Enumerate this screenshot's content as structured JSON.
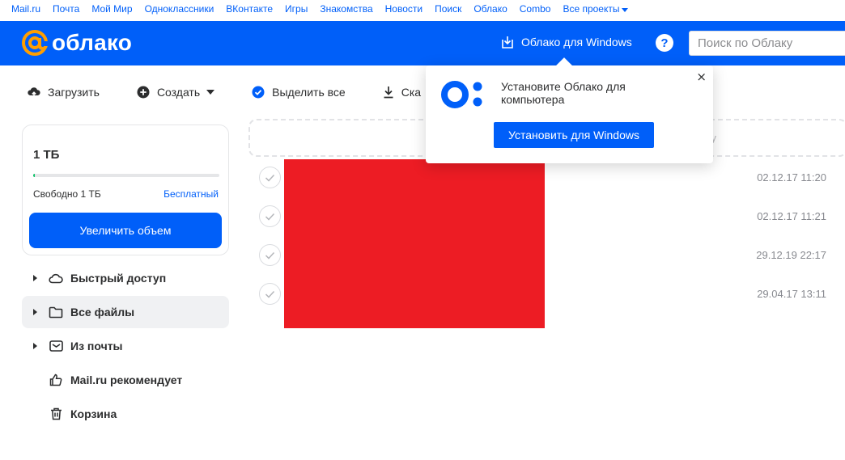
{
  "portal": {
    "links": [
      "Mail.ru",
      "Почта",
      "Мой Мир",
      "Одноклассники",
      "ВКонтакте",
      "Игры",
      "Знакомства",
      "Новости",
      "Поиск",
      "Облако",
      "Combo"
    ],
    "more_label": "Все проекты"
  },
  "header": {
    "logo_text": "облако",
    "windows_link": "Облако для Windows",
    "help_label": "?",
    "search_placeholder": "Поиск по Облаку"
  },
  "toolbar": {
    "upload": "Загрузить",
    "create": "Создать",
    "select_all": "Выделить все",
    "download": "Ска"
  },
  "storage": {
    "size": "1 ТБ",
    "free": "Свободно 1 ТБ",
    "plan": "Бесплатный",
    "used_fraction": 0.01,
    "upgrade_button": "Увеличить объем"
  },
  "nav": {
    "items": [
      {
        "label": "Быстрый доступ",
        "icon": "cloud-icon",
        "expandable": true
      },
      {
        "label": "Все файлы",
        "icon": "folder-icon",
        "expandable": true
      },
      {
        "label": "Из почты",
        "icon": "mail-icon",
        "expandable": true
      },
      {
        "label": "Mail.ru рекомендует",
        "icon": "thumbs-up-icon",
        "expandable": false
      },
      {
        "label": "Корзина",
        "icon": "trash-icon",
        "expandable": false
      }
    ],
    "active_index": 1
  },
  "dropzone": {
    "text": "у"
  },
  "files": {
    "rows": [
      {
        "date": "02.12.17 11:20"
      },
      {
        "date": "02.12.17 11:21"
      },
      {
        "date": "29.12.19 22:17"
      },
      {
        "date": "29.04.17 13:11"
      }
    ]
  },
  "popup": {
    "text": "Установите Облако для компьютера",
    "button": "Установить для Windows",
    "close": "×"
  },
  "colors": {
    "brand_blue": "#005ff9",
    "logo_orange": "#ff9e00",
    "redaction": "#ed1c24",
    "storage_fill": "#0dc268"
  }
}
